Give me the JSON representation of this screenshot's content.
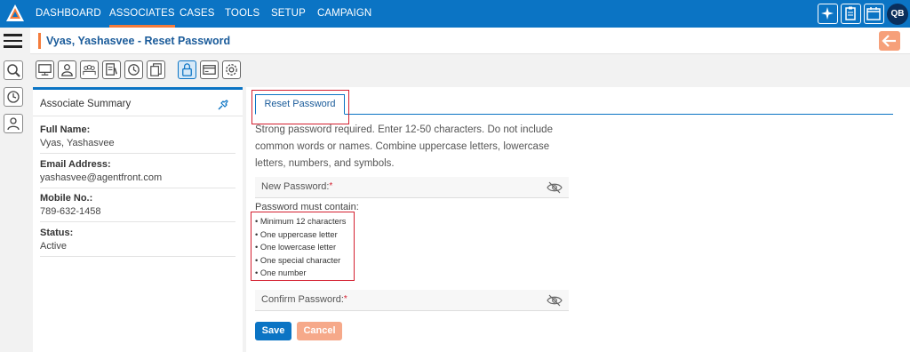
{
  "nav": {
    "items": [
      "DASHBOARD",
      "ASSOCIATES",
      "CASES",
      "TOOLS",
      "SETUP",
      "CAMPAIGN"
    ],
    "active": "ASSOCIATES",
    "user_initials": "QB"
  },
  "header": {
    "title": "Vyas, Yashasvee - Reset Password"
  },
  "summary": {
    "title": "Associate Summary",
    "fields": [
      {
        "label": "Full Name:",
        "value": "Vyas, Yashasvee"
      },
      {
        "label": "Email Address:",
        "value": "yashasvee@agentfront.com"
      },
      {
        "label": "Mobile No.:",
        "value": "789-632-1458"
      },
      {
        "label": "Status:",
        "value": "Active"
      }
    ]
  },
  "form": {
    "tab_label": "Reset Password",
    "info_text": "Strong password required. Enter 12-50 characters. Do not include common words or names. Combine uppercase letters, lowercase letters, numbers, and symbols.",
    "new_password_label": "New Password:",
    "confirm_password_label": "Confirm Password:",
    "required_marker": "*",
    "rules_heading": "Password must contain:",
    "rules": [
      "• Minimum 12 characters",
      "• One uppercase letter",
      "• One lowercase letter",
      "• One special character",
      "• One number"
    ],
    "save_label": "Save",
    "cancel_label": "Cancel"
  },
  "icons": {
    "toolbar": [
      "desktop-icon",
      "person-icon",
      "people-icon",
      "document-edit-icon",
      "clock-icon",
      "documents-icon",
      "lock-icon",
      "card-icon",
      "gear-icon"
    ],
    "rail": [
      "hamburger-icon",
      "search-icon",
      "history-icon",
      "user-settings-icon"
    ],
    "top_right": [
      "sparkle-icon",
      "clipboard-icon",
      "calendar-icon"
    ]
  },
  "colors": {
    "primary": "#0b74c4",
    "accent": "#f47c3c",
    "highlight": "#d42030"
  }
}
